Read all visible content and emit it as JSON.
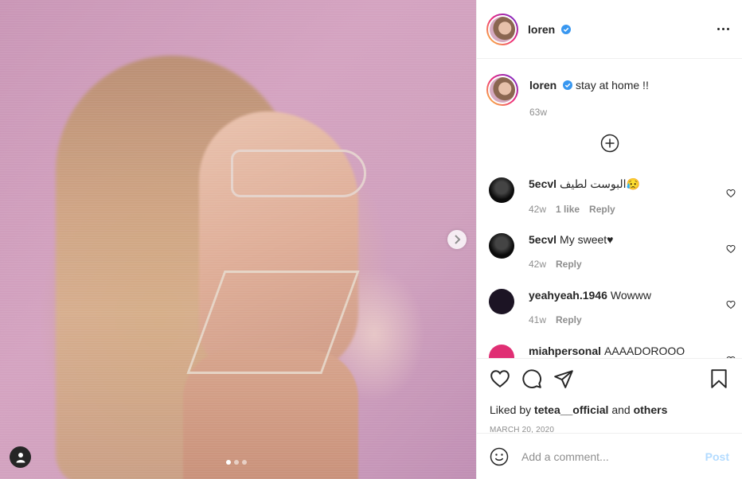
{
  "post": {
    "image_alt": "Photo of a woman with blonde hair wearing sunglasses and a geometric earring against a pink background",
    "carousel": {
      "current": 1,
      "total": 3
    }
  },
  "header": {
    "username": "loren",
    "verified": true
  },
  "caption": {
    "username": "loren",
    "text": "stay at home !!",
    "age": "63w"
  },
  "comments": [
    {
      "username": "5ecvl",
      "text": "البوست لطيف😥",
      "age": "42w",
      "likes": "1 like",
      "reply": "Reply"
    },
    {
      "username": "5ecvl",
      "text": "My sweet♥",
      "age": "42w",
      "reply": "Reply"
    },
    {
      "username": "yeahyeah.1946",
      "text": "Wowww",
      "age": "41w",
      "reply": "Reply"
    },
    {
      "username": "miahpersonal",
      "text": "AAAADOROOO"
    }
  ],
  "likes": {
    "prefix": "Liked by",
    "user": "tetea__official",
    "conjunction": "and",
    "others": "others"
  },
  "date": "MARCH 20, 2020",
  "add_comment": {
    "placeholder": "Add a comment...",
    "post_label": "Post"
  },
  "icons": {
    "like": "heart-icon",
    "comment": "comment-bubble-icon",
    "share": "paper-plane-icon",
    "save": "bookmark-icon",
    "more": "ellipsis-icon",
    "emoji": "smiley-icon",
    "load_more": "plus-circle-icon",
    "next": "chevron-right-icon",
    "tag": "user-tag-icon"
  },
  "colors": {
    "verified": "#3897f0",
    "post_disabled": "#b3dbff",
    "muted": "#8e8e8e"
  }
}
